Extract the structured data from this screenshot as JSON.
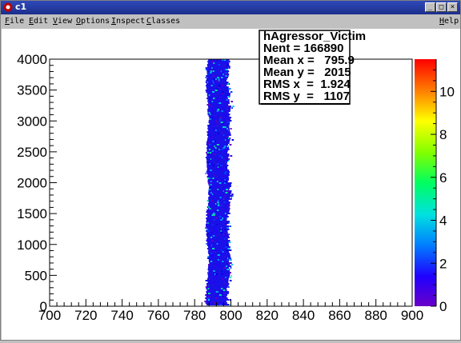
{
  "window": {
    "title": "c1"
  },
  "menu": {
    "items": [
      {
        "label": "File",
        "accel": "F",
        "rest": "ile"
      },
      {
        "label": "Edit",
        "accel": "E",
        "rest": "dit"
      },
      {
        "label": "View",
        "accel": "V",
        "rest": "iew"
      },
      {
        "label": "Options",
        "accel": "O",
        "rest": "ptions"
      },
      {
        "label": "Inspect",
        "accel": "I",
        "rest": "nspect"
      },
      {
        "label": "Classes",
        "accel": "C",
        "rest": "lasses"
      }
    ],
    "help": {
      "label": "Help",
      "accel": "H",
      "rest": "elp"
    }
  },
  "stats": {
    "name": "hAgressor_Victim",
    "lines": [
      "Nent = 166890",
      "Mean x =   795.9",
      "Mean y =   2015",
      "RMS x  =  1.924",
      "RMS y  =   1107"
    ]
  },
  "chart_data": {
    "type": "heatmap",
    "title": "",
    "xlabel": "",
    "ylabel": "",
    "xlim": [
      700,
      900
    ],
    "ylim": [
      0,
      4000
    ],
    "x_ticks": [
      "700",
      "720",
      "740",
      "760",
      "780",
      "800",
      "820",
      "840",
      "860",
      "880",
      "900"
    ],
    "y_ticks": [
      "0",
      "500",
      "1000",
      "1500",
      "2000",
      "2500",
      "3000",
      "3500",
      "4000"
    ],
    "z_ticks": [
      "0",
      "2",
      "4",
      "6",
      "8",
      "10"
    ],
    "zlim": [
      0,
      11.5
    ],
    "band_x_range": [
      787,
      799
    ],
    "colors": {
      "frame": "#000000",
      "palette": [
        "#6a00c8",
        "#0000ff",
        "#00a0ff",
        "#00ffa0",
        "#40ff00",
        "#ffff00",
        "#ff8000",
        "#ff0000"
      ]
    }
  }
}
